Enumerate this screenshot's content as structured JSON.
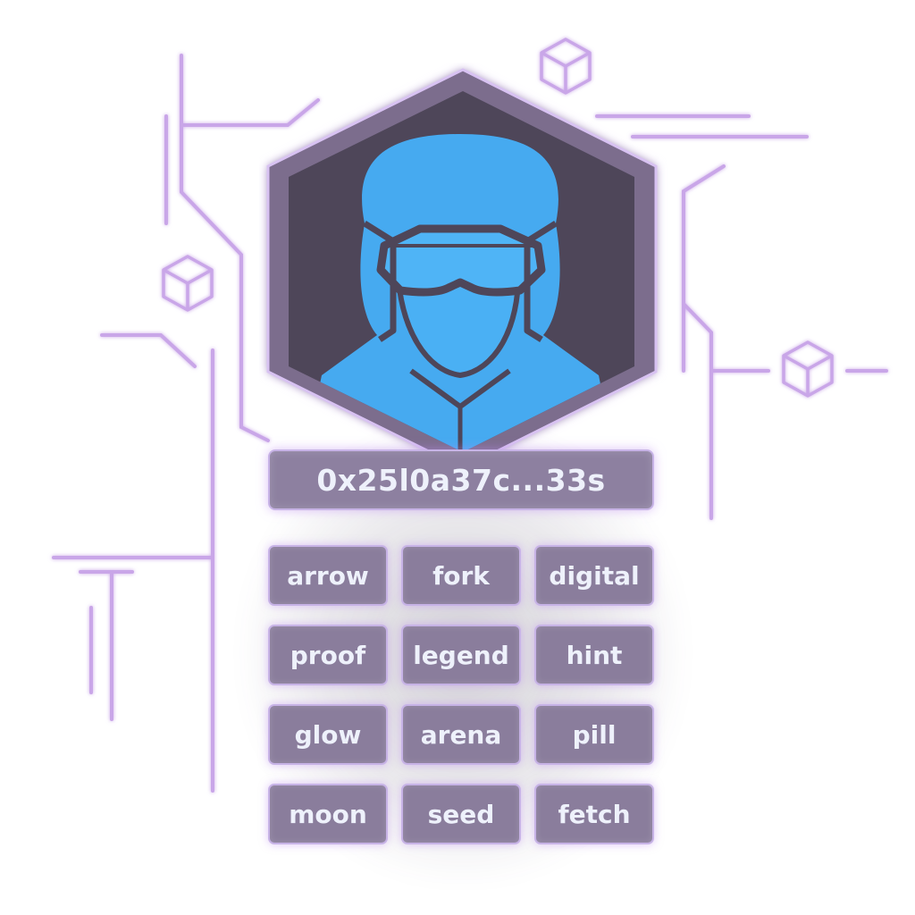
{
  "profile": {
    "address": "0x25l0a37c...33s",
    "avatar_icon": "operator-visor-icon"
  },
  "seed_words": [
    "arrow",
    "fork",
    "digital",
    "proof",
    "legend",
    "hint",
    "glow",
    "arena",
    "pill",
    "moon",
    "seed",
    "fetch"
  ],
  "colors": {
    "circuit": "#c7a3e6",
    "tile": "#8a7d9c",
    "tile_border": "#c7b3e6",
    "text": "#eef1fb",
    "hex_frame": "#7a6b8c",
    "hex_inner": "#4d4558",
    "avatar": "#44a8ef"
  }
}
